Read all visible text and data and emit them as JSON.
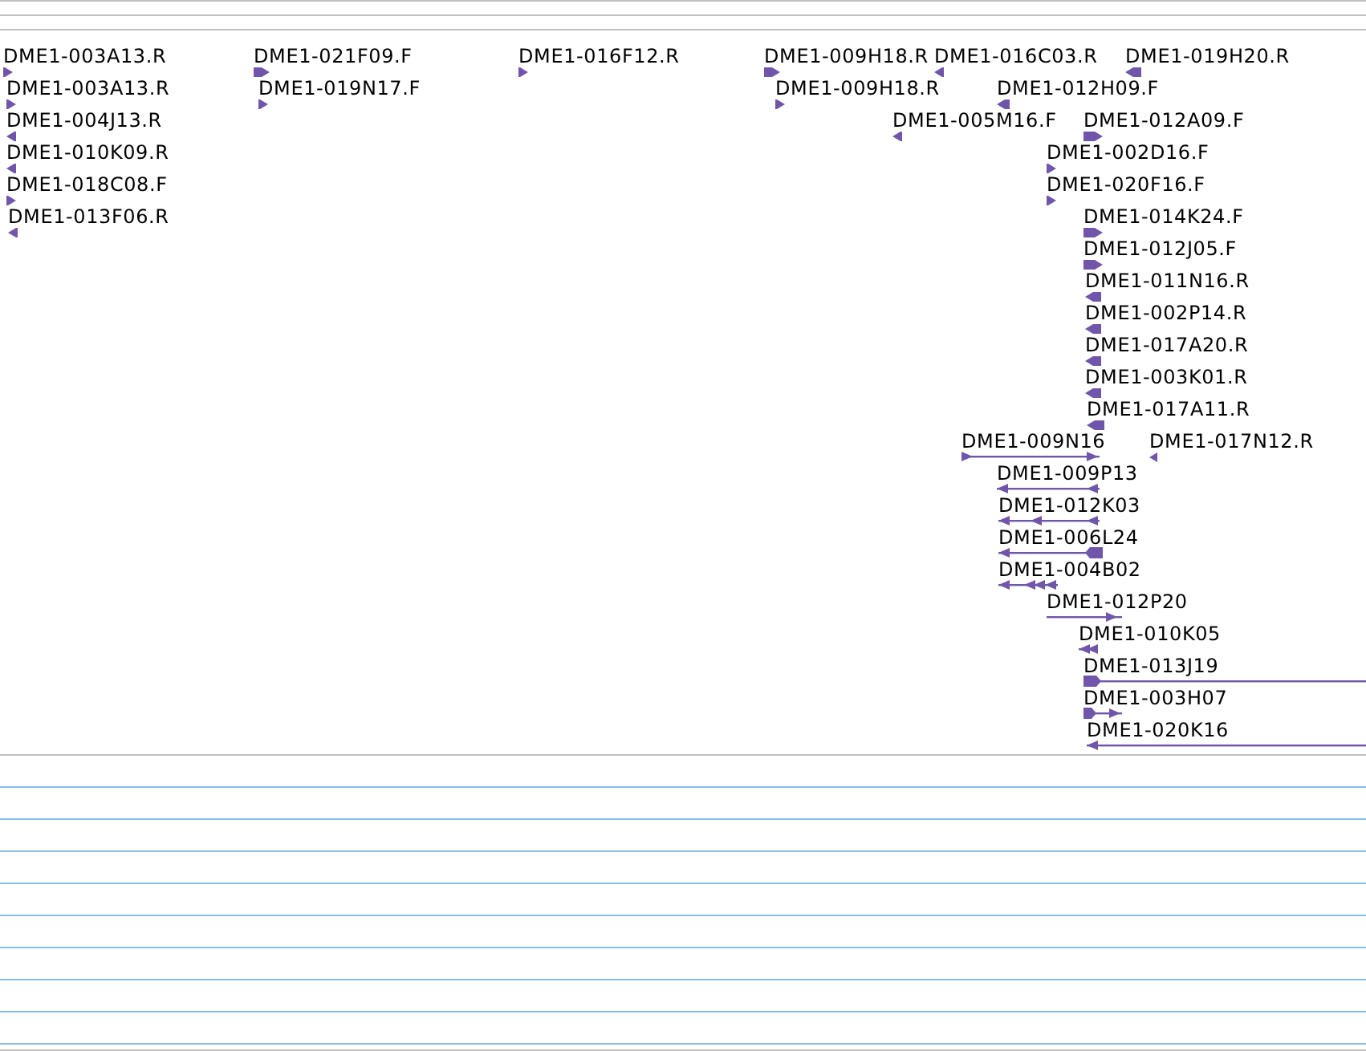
{
  "features": [
    {
      "label": "DME1-003A13.R",
      "kind": "forward"
    },
    {
      "label": "DME1-003A13.R",
      "kind": "forward"
    },
    {
      "label": "DME1-004J13.R",
      "kind": "reverse"
    },
    {
      "label": "DME1-010K09.R",
      "kind": "reverse"
    },
    {
      "label": "DME1-018C08.F",
      "kind": "forward"
    },
    {
      "label": "DME1-013F06.R",
      "kind": "reverse"
    },
    {
      "label": "DME1-021F09.F",
      "kind": "forward"
    },
    {
      "label": "DME1-019N17.F",
      "kind": "forward"
    },
    {
      "label": "DME1-016F12.R",
      "kind": "forward"
    },
    {
      "label": "DME1-009H18.R",
      "kind": "forward"
    },
    {
      "label": "DME1-009H18.R",
      "kind": "forward"
    },
    {
      "label": "DME1-016C03.R",
      "kind": "reverse"
    },
    {
      "label": "DME1-019H20.R",
      "kind": "reverse"
    },
    {
      "label": "DME1-012H09.F",
      "kind": "reverse"
    },
    {
      "label": "DME1-005M16.F",
      "kind": "reverse"
    },
    {
      "label": "DME1-012A09.F",
      "kind": "forward"
    },
    {
      "label": "DME1-002D16.F",
      "kind": "forward"
    },
    {
      "label": "DME1-020F16.F",
      "kind": "forward"
    },
    {
      "label": "DME1-014K24.F",
      "kind": "forward"
    },
    {
      "label": "DME1-012J05.F",
      "kind": "forward"
    },
    {
      "label": "DME1-011N16.R",
      "kind": "reverse"
    },
    {
      "label": "DME1-002P14.R",
      "kind": "reverse"
    },
    {
      "label": "DME1-017A20.R",
      "kind": "reverse"
    },
    {
      "label": "DME1-003K01.R",
      "kind": "reverse"
    },
    {
      "label": "DME1-017A11.R",
      "kind": "reverse"
    },
    {
      "label": "DME1-009N16",
      "kind": "forward"
    },
    {
      "label": "DME1-017N12.R",
      "kind": "reverse"
    },
    {
      "label": "DME1-009P13",
      "kind": "reverse"
    },
    {
      "label": "DME1-012K03",
      "kind": "reverse"
    },
    {
      "label": "DME1-006L24",
      "kind": "reverse"
    },
    {
      "label": "DME1-004B02",
      "kind": "reverse"
    },
    {
      "label": "DME1-012P20",
      "kind": "forward"
    },
    {
      "label": "DME1-010K05",
      "kind": "reverse"
    },
    {
      "label": "DME1-013J19",
      "kind": "forward"
    },
    {
      "label": "DME1-003H07",
      "kind": "forward"
    },
    {
      "label": "DME1-020K16",
      "kind": "reverse"
    }
  ]
}
